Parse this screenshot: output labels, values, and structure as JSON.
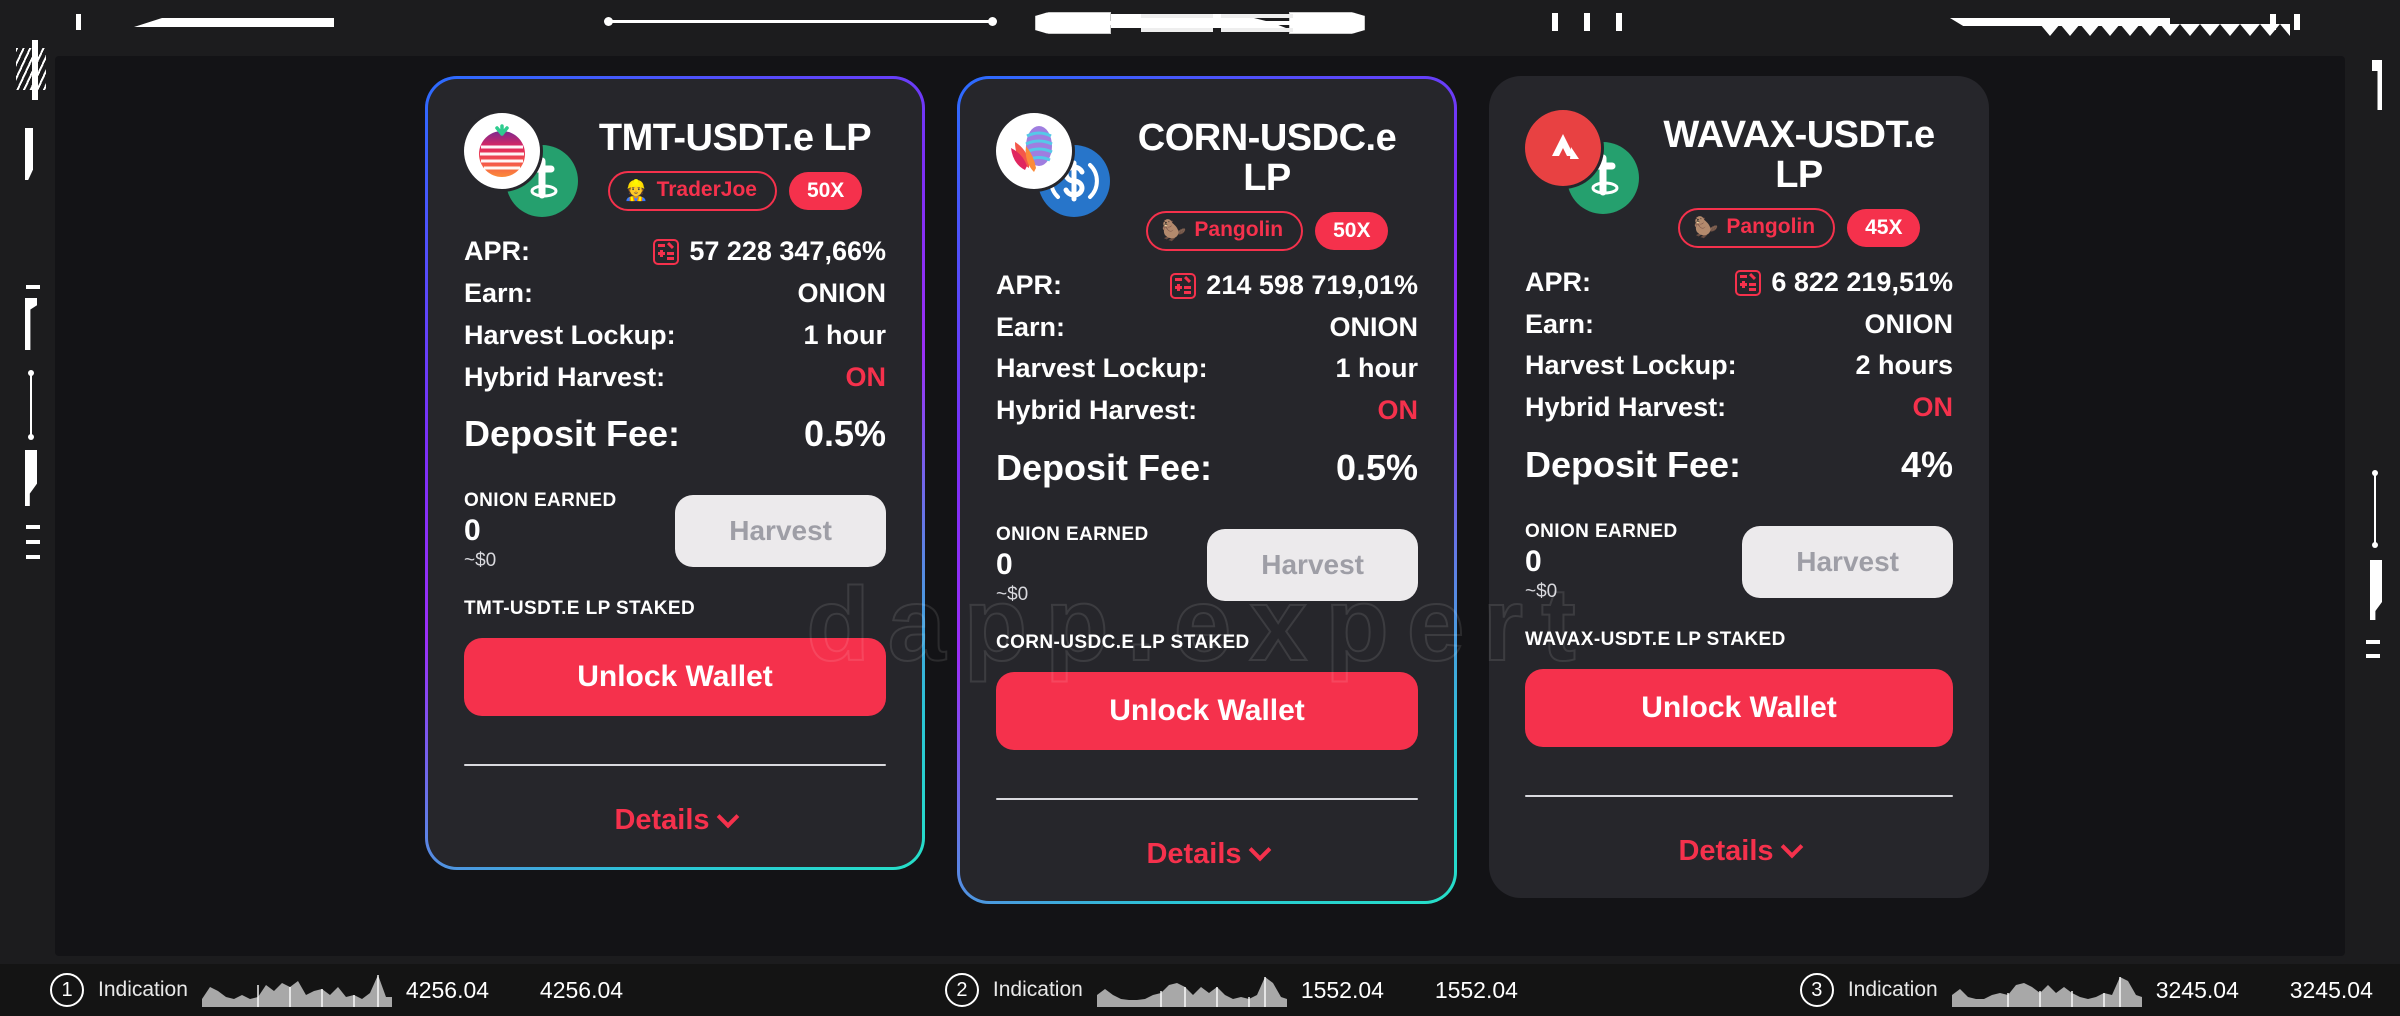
{
  "app": {
    "watermark": "dapp.expert",
    "background": "#1c1c1e",
    "stage_bg": "#131316",
    "accent_red": "#f5314c",
    "card_bg": "#26262b"
  },
  "farms": [
    {
      "pair": "TMT-USDT.e LP",
      "logo_primary": "tomato-token-icon",
      "logo_secondary": "onion-token-icon",
      "dex": "TraderJoe",
      "dex_emoji": "construction-worker-icon",
      "multiplier": "50X",
      "apr_label": "APR:",
      "apr_value": "57 228 347,66%",
      "apr_calc_icon": "calculator-icon",
      "earn_label": "Earn:",
      "earn_value": "ONION",
      "lockup_label": "Harvest Lockup:",
      "lockup_value": "1 hour",
      "hybrid_label": "Hybrid Harvest:",
      "hybrid_value": "ON",
      "fee_label": "Deposit Fee:",
      "fee_value": "0.5%",
      "earned_title": "ONION EARNED",
      "earned_amount": "0",
      "earned_usd": "~$0",
      "harvest_label": "Harvest",
      "staked_title": "TMT-USDT.E LP STAKED",
      "unlock_label": "Unlock Wallet",
      "details_label": "Details",
      "gradient": true
    },
    {
      "pair": "CORN-USDC.e LP",
      "logo_primary": "corn-token-icon",
      "logo_secondary": "usdc-token-icon",
      "dex": "Pangolin",
      "dex_emoji": "pangolin-icon",
      "multiplier": "50X",
      "apr_label": "APR:",
      "apr_value": "214 598 719,01%",
      "apr_calc_icon": "calculator-icon",
      "earn_label": "Earn:",
      "earn_value": "ONION",
      "lockup_label": "Harvest Lockup:",
      "lockup_value": "1 hour",
      "hybrid_label": "Hybrid Harvest:",
      "hybrid_value": "ON",
      "fee_label": "Deposit Fee:",
      "fee_value": "0.5%",
      "earned_title": "ONION EARNED",
      "earned_amount": "0",
      "earned_usd": "~$0",
      "harvest_label": "Harvest",
      "staked_title": "CORN-USDC.E LP STAKED",
      "unlock_label": "Unlock Wallet",
      "details_label": "Details",
      "gradient": true
    },
    {
      "pair": "WAVAX-USDT.e LP",
      "logo_primary": "avalanche-token-icon",
      "logo_secondary": "onion-token-icon",
      "dex": "Pangolin",
      "dex_emoji": "pangolin-icon",
      "multiplier": "45X",
      "apr_label": "APR:",
      "apr_value": "6 822 219,51%",
      "apr_calc_icon": "calculator-icon",
      "earn_label": "Earn:",
      "earn_value": "ONION",
      "lockup_label": "Harvest Lockup:",
      "lockup_value": "2 hours",
      "hybrid_label": "Hybrid Harvest:",
      "hybrid_value": "ON",
      "fee_label": "Deposit Fee:",
      "fee_value": "4%",
      "earned_title": "ONION EARNED",
      "earned_amount": "0",
      "earned_usd": "~$0",
      "harvest_label": "Harvest",
      "staked_title": "WAVAX-USDT.E LP STAKED",
      "unlock_label": "Unlock Wallet",
      "details_label": "Details",
      "gradient": false
    }
  ],
  "statusbar": {
    "indicators": [
      {
        "num": "1",
        "label": "Indication",
        "value_a": "4256.04",
        "value_b": "4256.04"
      },
      {
        "num": "2",
        "label": "Indication",
        "value_a": "1552.04",
        "value_b": "1552.04"
      },
      {
        "num": "3",
        "label": "Indication",
        "value_a": "3245.04",
        "value_b": "3245.04"
      }
    ]
  }
}
